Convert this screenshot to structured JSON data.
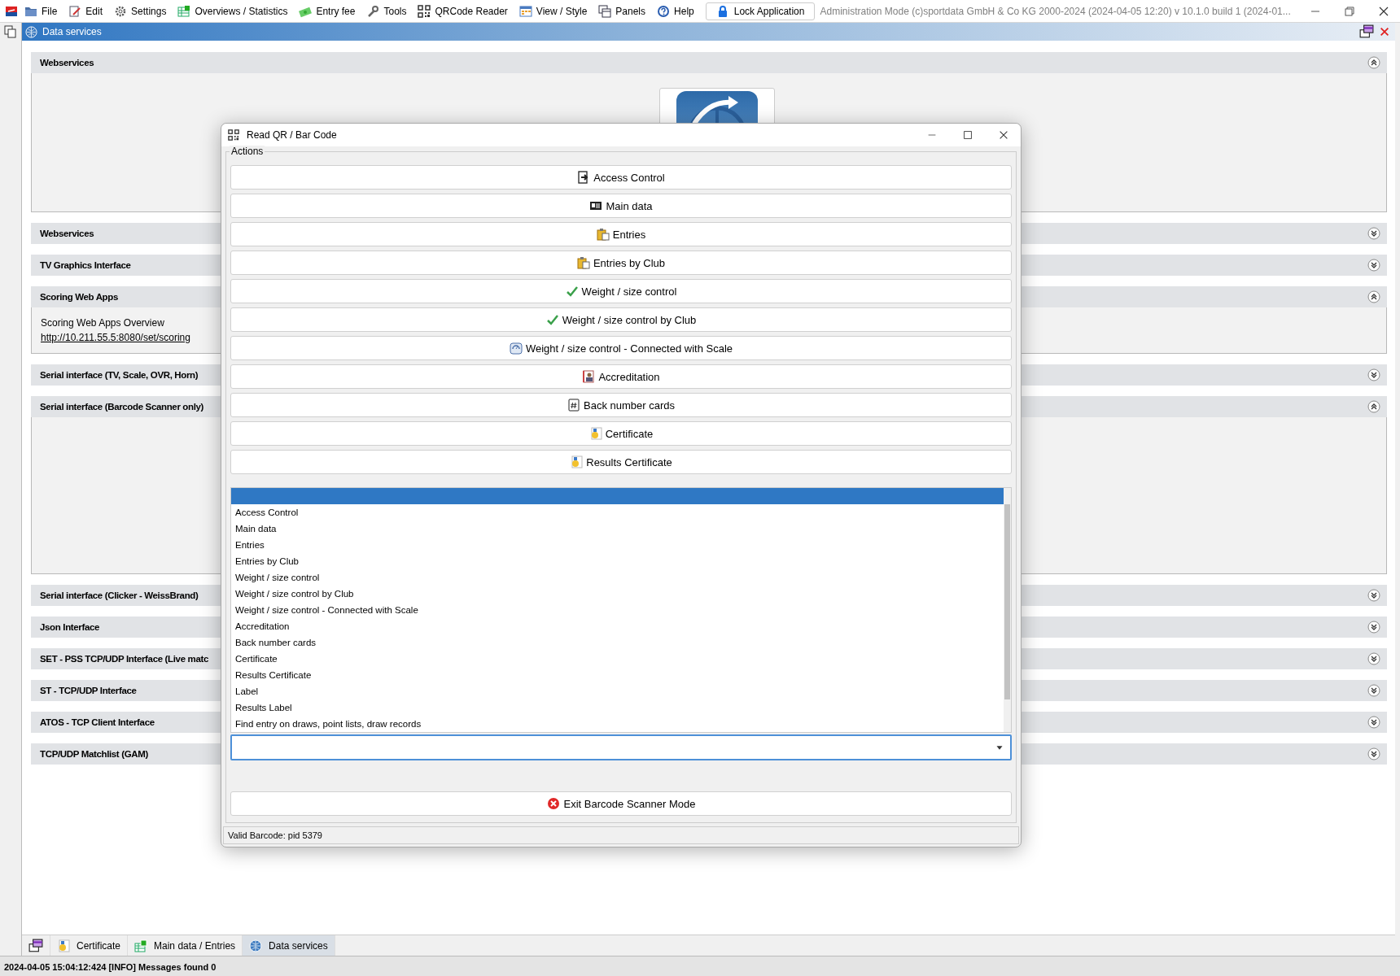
{
  "menu": [
    {
      "label": "File"
    },
    {
      "label": "Edit"
    },
    {
      "label": "Settings"
    },
    {
      "label": "Overviews / Statistics"
    },
    {
      "label": "Entry fee"
    },
    {
      "label": "Tools"
    },
    {
      "label": "QRCode Reader"
    },
    {
      "label": "View / Style"
    },
    {
      "label": "Panels"
    },
    {
      "label": "Help"
    }
  ],
  "lock_button": "Lock Application",
  "app_info": "Administration Mode (c)sportdata GmbH & Co KG 2000-2024 (2024-04-05 12:20)  v 10.1.0 build 1 (2024-01...",
  "child_window": {
    "title": "Data services"
  },
  "sections": [
    {
      "title": "Webservices",
      "expanded": true,
      "kind": "logo"
    },
    {
      "title": "Webservices",
      "expanded": false
    },
    {
      "title": "TV Graphics Interface",
      "expanded": false
    },
    {
      "title": "Scoring Web Apps",
      "expanded": true,
      "kind": "text",
      "text": "Scoring Web Apps Overview",
      "link": "http://10.211.55.5:8080/set/scoring"
    },
    {
      "title": "Serial interface (TV, Scale, OVR, Horn)",
      "expanded": false
    },
    {
      "title": "Serial interface (Barcode Scanner only)",
      "expanded": true,
      "kind": "empty"
    },
    {
      "title": "Serial interface (Clicker - WeissBrand)",
      "expanded": false
    },
    {
      "title": "Json Interface",
      "expanded": false
    },
    {
      "title": "SET - PSS TCP/UDP Interface (Live matc",
      "expanded": false
    },
    {
      "title": "ST - TCP/UDP Interface",
      "expanded": false
    },
    {
      "title": "ATOS - TCP Client Interface",
      "expanded": false
    },
    {
      "title": "TCP/UDP Matchlist (GAM)",
      "expanded": false
    }
  ],
  "bottom_tabs": [
    {
      "label": "Certificate",
      "selected": false
    },
    {
      "label": "Main data / Entries",
      "selected": false
    },
    {
      "label": "Data services",
      "selected": true
    }
  ],
  "status_line": "2024-04-05 15:04:12:424 [INFO] Messages found 0",
  "dialog": {
    "title": "Read QR / Bar Code",
    "group_label": "Actions",
    "actions": [
      "Access Control",
      "Main data",
      "Entries",
      "Entries by Club",
      "Weight / size control",
      "Weight / size control by Club",
      "Weight / size control - Connected with Scale",
      "Accreditation",
      "Back number cards",
      "Certificate",
      "Results Certificate"
    ],
    "dropdown": {
      "blank_option_selected": true,
      "options": [
        {
          "label": "Access Control",
          "selected": false
        },
        {
          "label": "Main data",
          "selected": false
        },
        {
          "label": "Entries",
          "selected": false
        },
        {
          "label": "Entries by Club",
          "selected": false
        },
        {
          "label": "Weight / size control",
          "selected": false
        },
        {
          "label": "Weight / size control by Club",
          "selected": false
        },
        {
          "label": "Weight / size control - Connected with Scale",
          "selected": false
        },
        {
          "label": "Accreditation",
          "selected": false
        },
        {
          "label": "Back number cards",
          "selected": false
        },
        {
          "label": "Certificate",
          "selected": false
        },
        {
          "label": "Results Certificate",
          "selected": false
        },
        {
          "label": "Label",
          "selected": false
        },
        {
          "label": "Results Label",
          "selected": false
        },
        {
          "label": "Find entry on draws, point lists, draw records",
          "selected": false
        }
      ]
    },
    "exit_button": "Exit Barcode Scanner Mode",
    "status": "Valid Barcode: pid 5379"
  }
}
